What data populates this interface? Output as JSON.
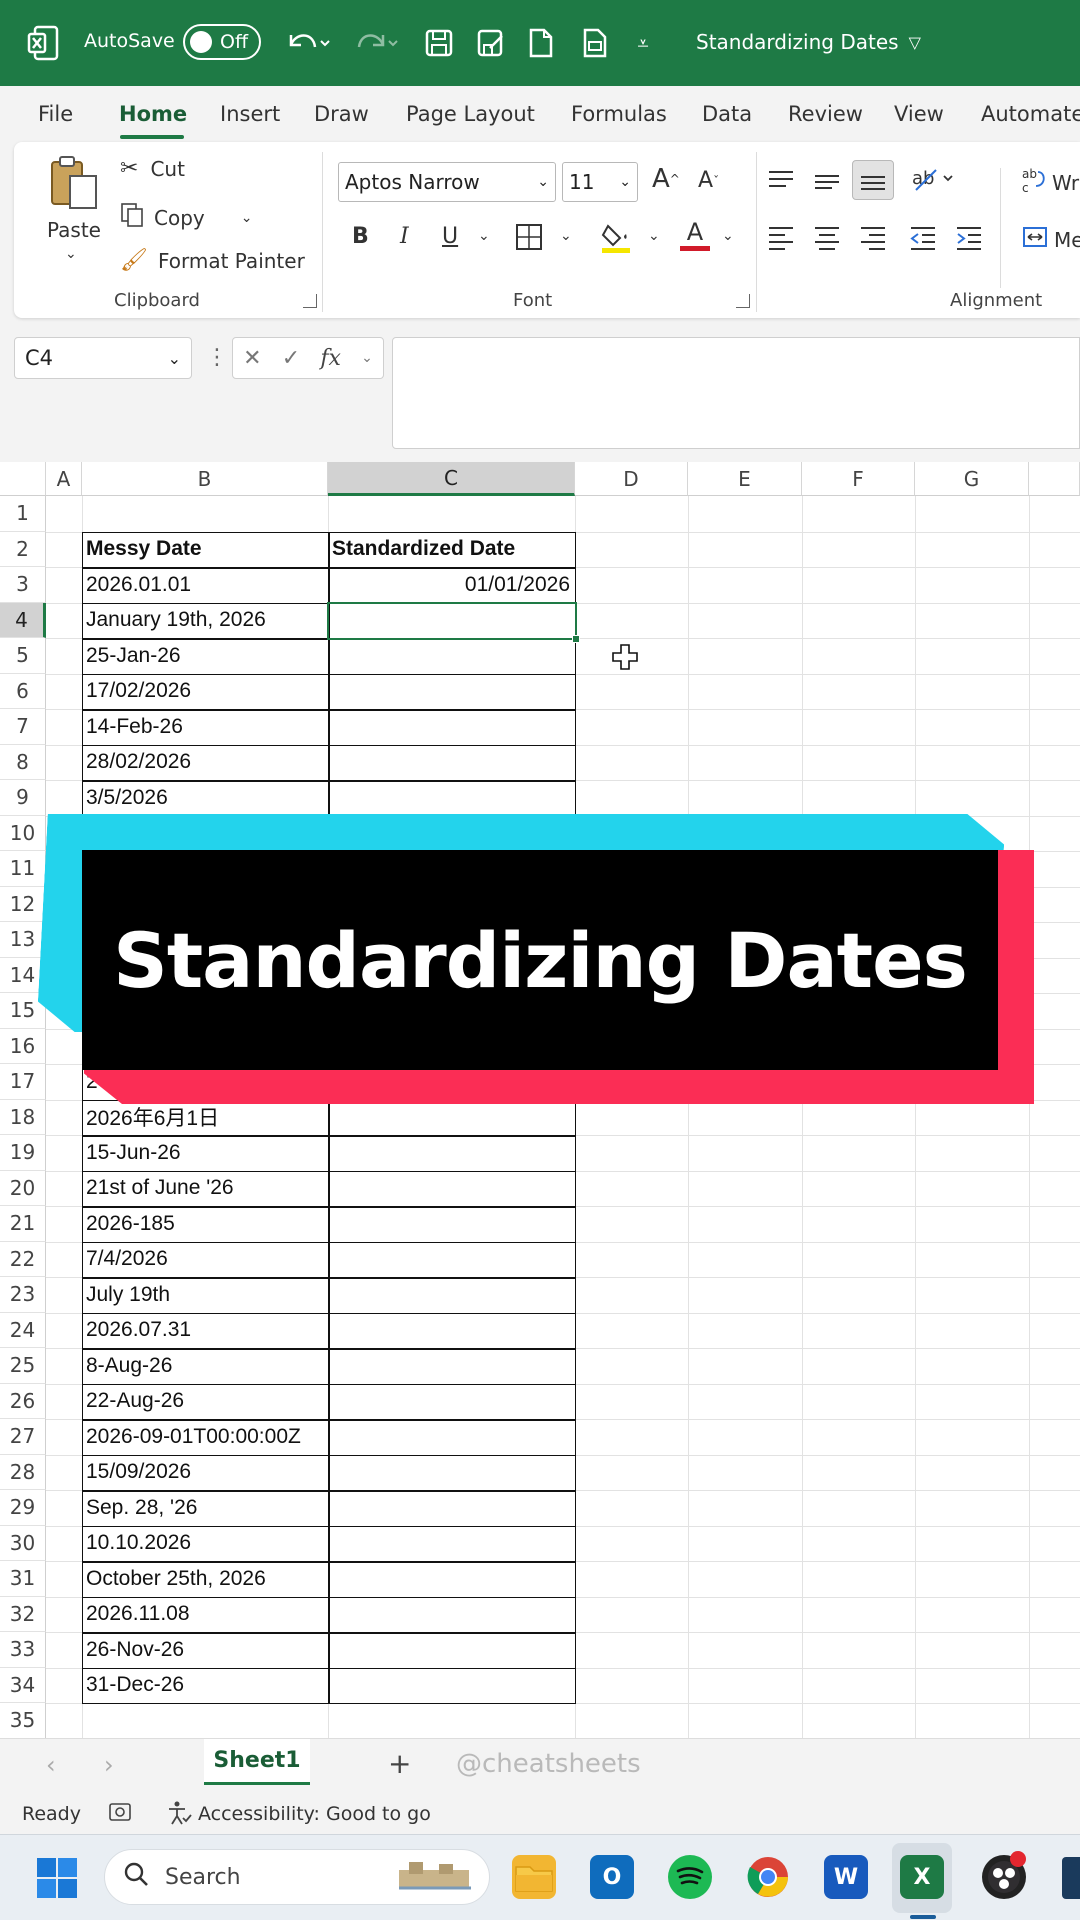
{
  "window": {
    "autosave_label": "AutoSave",
    "autosave_state": "Off",
    "doc_title": "Standardizing Dates",
    "accent": "#1e7a45"
  },
  "ribbon_tabs": [
    "File",
    "Home",
    "Insert",
    "Draw",
    "Page Layout",
    "Formulas",
    "Data",
    "Review",
    "View",
    "Automate"
  ],
  "active_tab": "Home",
  "clipboard": {
    "paste": "Paste",
    "cut": "Cut",
    "copy": "Copy",
    "format_painter": "Format Painter",
    "group": "Clipboard"
  },
  "font": {
    "family": "Aptos Narrow",
    "size": "11",
    "bold": "B",
    "italic": "I",
    "underline": "U",
    "grow": "A",
    "shrink": "A",
    "font_color": "A",
    "group": "Font"
  },
  "alignment": {
    "wrap": "Wr",
    "merge": "Me",
    "group": "Alignment"
  },
  "formula_bar": {
    "name_box": "C4",
    "fx": "fx",
    "formula": ""
  },
  "columns": [
    "A",
    "B",
    "C",
    "D",
    "E",
    "F",
    "G"
  ],
  "rows": [
    "1",
    "2",
    "3",
    "4",
    "5",
    "6",
    "7",
    "8",
    "9",
    "10",
    "11",
    "12",
    "13",
    "14",
    "15",
    "16",
    "17",
    "18",
    "19",
    "20",
    "21",
    "22",
    "23",
    "24",
    "25",
    "26",
    "27",
    "28",
    "29",
    "30",
    "31",
    "32",
    "33",
    "34",
    "35"
  ],
  "table": {
    "header_b": "Messy Date",
    "header_c": "Standardized Date",
    "b_values": [
      "2026.01.01",
      "January 19th, 2026",
      "25-Jan-26",
      "17/02/2026",
      "14-Feb-26",
      "28/02/2026",
      "3/5/2026",
      "",
      "",
      "",
      "",
      "",
      "",
      "",
      "2",
      "2026年6月1日",
      "15-Jun-26",
      "21st of June '26",
      "2026-185",
      "7/4/2026",
      "July 19th",
      "2026.07.31",
      "8-Aug-26",
      "22-Aug-26",
      "2026-09-01T00:00:00Z",
      "15/09/2026",
      "Sep. 28, '26",
      "10.10.2026",
      "October 25th, 2026",
      "2026.11.08",
      "26-Nov-26",
      "31-Dec-26"
    ],
    "c_values": [
      "01/01/2026"
    ]
  },
  "banner": {
    "text": "Standardizing Dates"
  },
  "sheet_tabs": {
    "active": "Sheet1",
    "add": "+",
    "watermark": "@cheatsheets"
  },
  "status": {
    "ready": "Ready",
    "accessibility": "Accessibility: Good to go"
  },
  "taskbar": {
    "search": "Search"
  }
}
